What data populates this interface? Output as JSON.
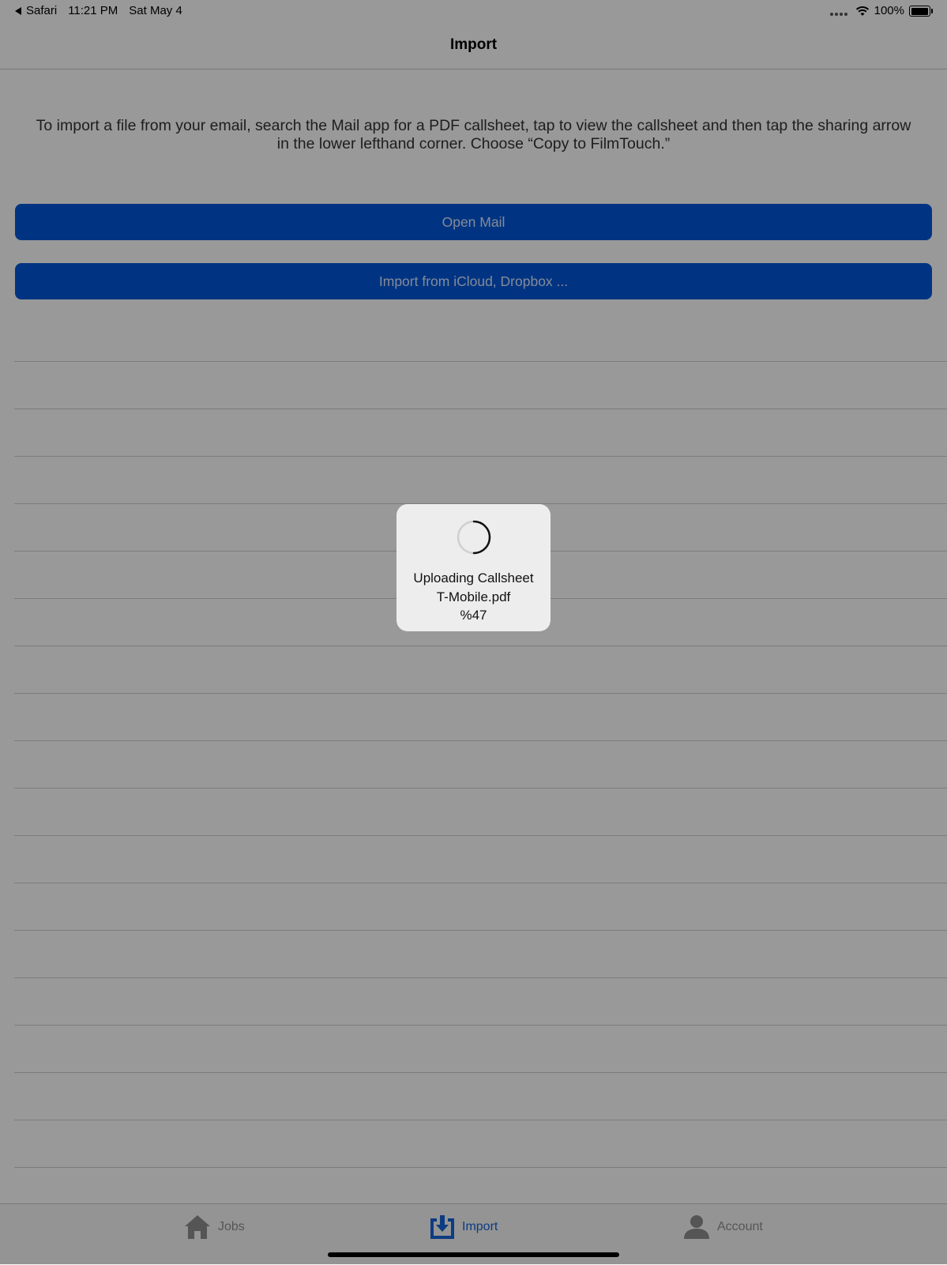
{
  "status_bar": {
    "back_app": "Safari",
    "time": "11:21 PM",
    "date": "Sat May 4",
    "battery": "100%",
    "icons": [
      "back-arrow-icon",
      "signal-icon",
      "wifi-icon",
      "battery-icon"
    ]
  },
  "nav": {
    "title": "Import"
  },
  "instructions": "To import a file from your email, search the Mail app for a PDF callsheet, tap to view the callsheet and then tap the sharing arrow in the lower lefthand corner. Choose “Copy to FilmTouch.”",
  "buttons": {
    "open_mail": "Open Mail",
    "import_cloud": "Import from iCloud, Dropbox ..."
  },
  "hud": {
    "line1": "Uploading Callsheet",
    "line2": "T-Mobile.pdf",
    "line3": "%47",
    "spinner_icon": "loading-spinner-icon"
  },
  "tabs": [
    {
      "label": "Jobs",
      "icon": "house-icon",
      "selected": false
    },
    {
      "label": "Import",
      "icon": "import-tray-icon",
      "selected": true
    },
    {
      "label": "Account",
      "icon": "person-icon",
      "selected": false
    }
  ],
  "colors": {
    "accent": "#0057d9",
    "selected_tab": "#1565d8",
    "overlay": "rgba(0,0,0,0.40)"
  }
}
